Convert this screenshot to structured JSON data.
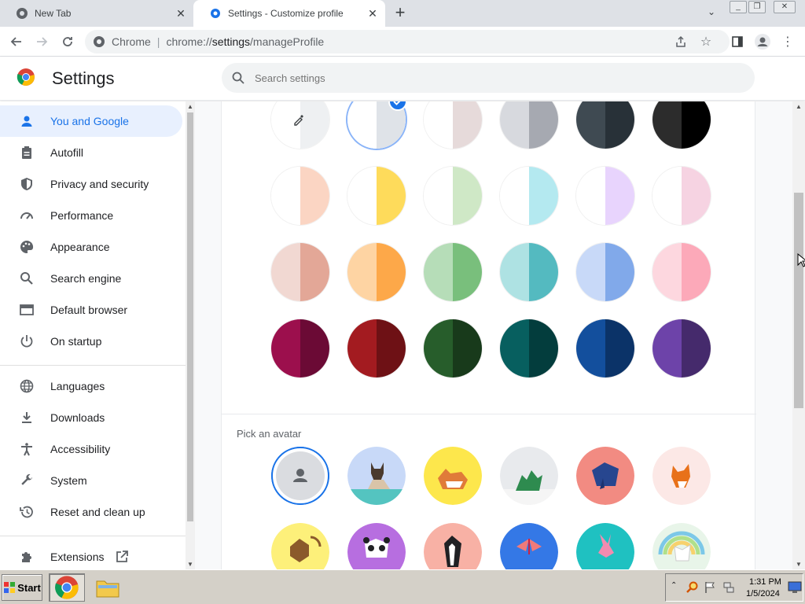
{
  "tabs": [
    {
      "label": "New Tab",
      "active": false
    },
    {
      "label": "Settings - Customize profile",
      "active": true
    }
  ],
  "omnibox": {
    "site": "Chrome",
    "url_prefix": "chrome://",
    "url_host": "settings",
    "url_path": "/manageProfile"
  },
  "header": {
    "title": "Settings",
    "search_placeholder": "Search settings"
  },
  "sidebar": {
    "items": [
      {
        "label": "You and Google",
        "icon": "person-icon",
        "active": true
      },
      {
        "label": "Autofill",
        "icon": "clipboard-icon"
      },
      {
        "label": "Privacy and security",
        "icon": "shield-icon"
      },
      {
        "label": "Performance",
        "icon": "gauge-icon"
      },
      {
        "label": "Appearance",
        "icon": "palette-icon"
      },
      {
        "label": "Search engine",
        "icon": "search-icon"
      },
      {
        "label": "Default browser",
        "icon": "browser-window-icon"
      },
      {
        "label": "On startup",
        "icon": "power-icon"
      },
      {
        "label": "Languages",
        "icon": "globe-icon"
      },
      {
        "label": "Downloads",
        "icon": "download-icon"
      },
      {
        "label": "Accessibility",
        "icon": "accessibility-icon"
      },
      {
        "label": "System",
        "icon": "wrench-icon"
      },
      {
        "label": "Reset and clean up",
        "icon": "history-icon"
      },
      {
        "label": "Extensions",
        "icon": "puzzle-icon"
      }
    ]
  },
  "theme_colors": [
    [
      [
        "#ffffff",
        "#eef0f2"
      ],
      [
        "#ffffff",
        "#dfe3e8"
      ],
      [
        "#ffffff",
        "#e6dada"
      ],
      [
        "#d7d9de",
        "#a6a9b1"
      ],
      [
        "#3f4a52",
        "#283138"
      ],
      [
        "#2c2c2c",
        "#000000"
      ]
    ],
    [
      [
        "#ffffff",
        "#fbd5c3"
      ],
      [
        "#ffffff",
        "#fedb5b"
      ],
      [
        "#ffffff",
        "#cfe8c6"
      ],
      [
        "#ffffff",
        "#b4e9f0"
      ],
      [
        "#ffffff",
        "#e8d4fd"
      ],
      [
        "#ffffff",
        "#f6d3e2"
      ]
    ],
    [
      [
        "#f1d8d2",
        "#e3a797"
      ],
      [
        "#fed4a3",
        "#fda849"
      ],
      [
        "#b6ddb8",
        "#79bf7c"
      ],
      [
        "#aee2e3",
        "#54bac0"
      ],
      [
        "#c8d9f8",
        "#81a9ea"
      ],
      [
        "#fdd7df",
        "#fca9b9"
      ]
    ],
    [
      [
        "#9c0f4d",
        "#6b0a35"
      ],
      [
        "#a31b20",
        "#6e1115"
      ],
      [
        "#275d2b",
        "#183a1b"
      ],
      [
        "#075f5f",
        "#033d3d"
      ],
      [
        "#134f9d",
        "#0b3368"
      ],
      [
        "#6d43a9",
        "#452a6c"
      ]
    ]
  ],
  "selected_theme": "1",
  "avatar_section": {
    "label": "Pick an avatar"
  },
  "avatars": [
    "default-person",
    "cat",
    "corgi",
    "dragon",
    "elephant",
    "fox",
    "monkey",
    "panda",
    "penguin",
    "butterfly",
    "rabbit",
    "unicorn"
  ],
  "taskbar": {
    "start_label": "Start",
    "time": "1:31 PM",
    "date": "1/5/2024"
  }
}
